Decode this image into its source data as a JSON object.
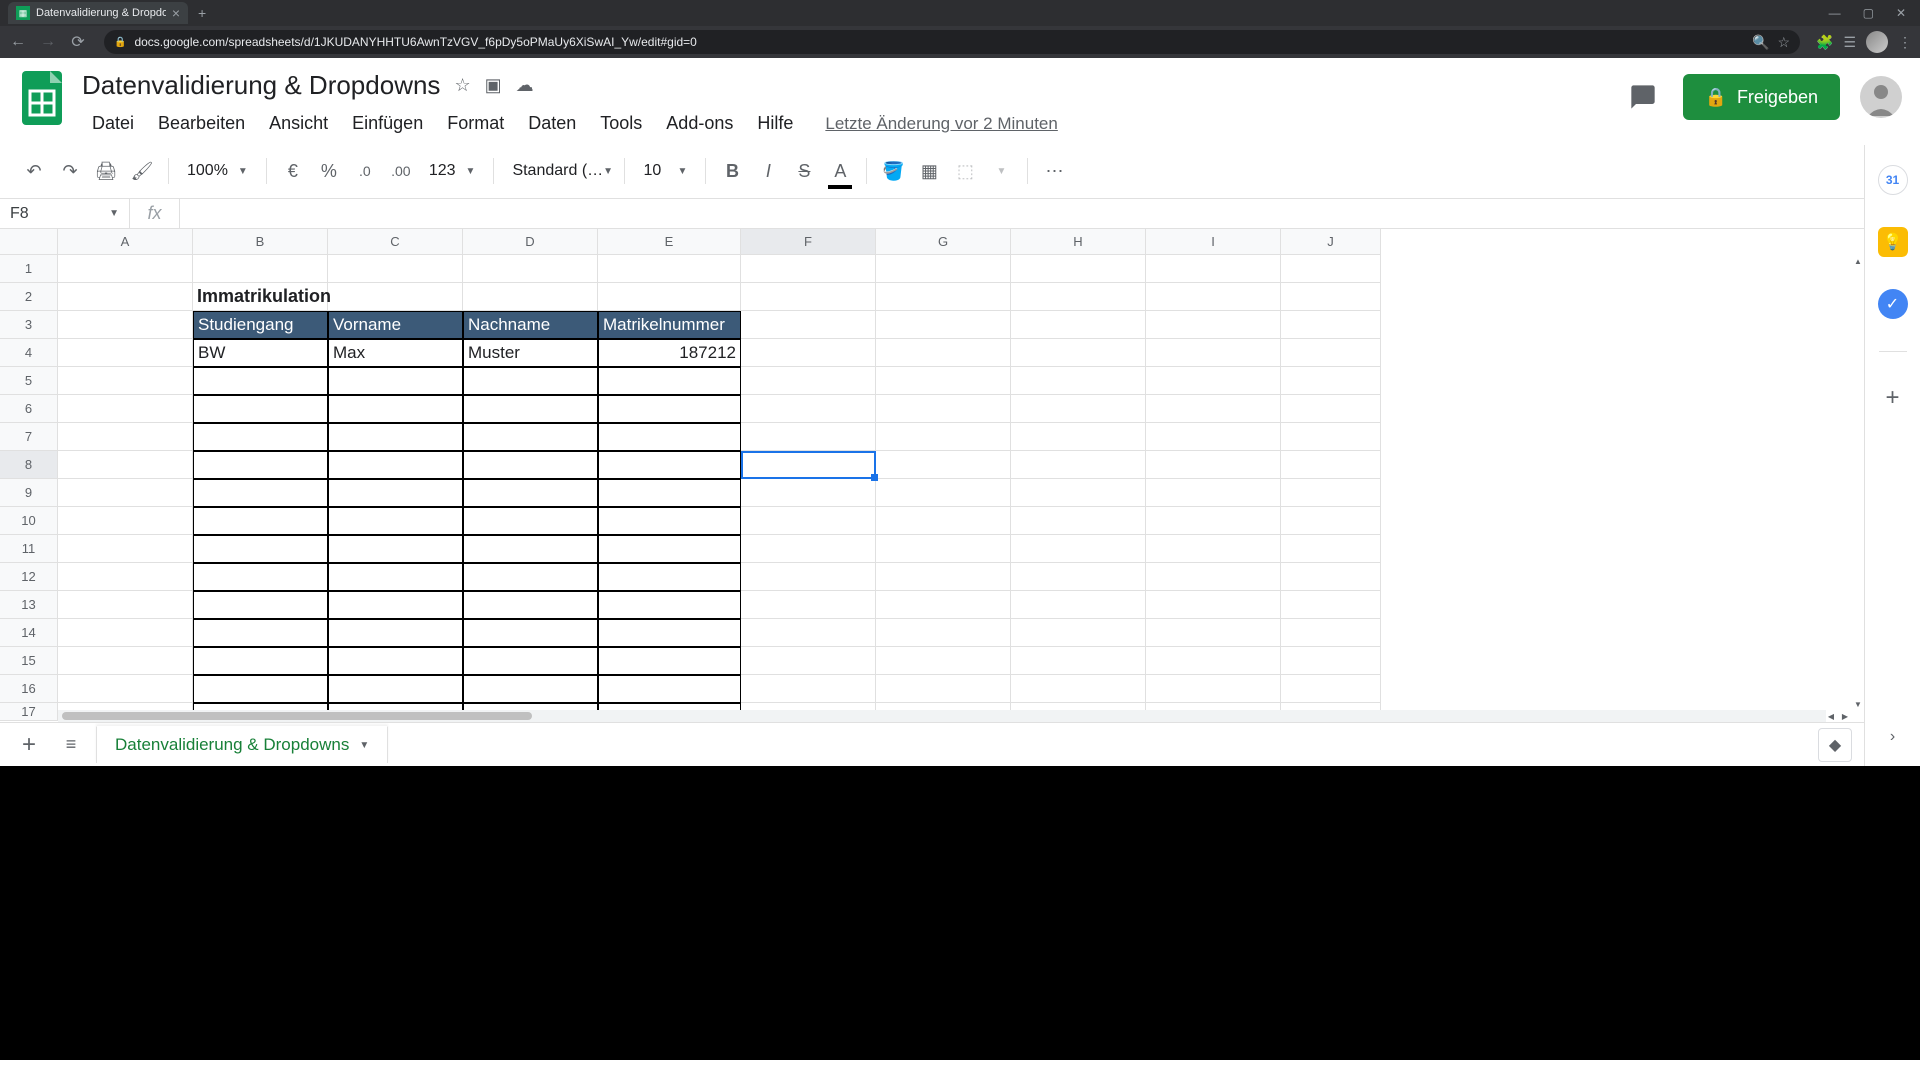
{
  "browser": {
    "tab_title": "Datenvalidierung & Dropdowns",
    "url": "docs.google.com/spreadsheets/d/1JKUDANYHHTU6AwnTzVGV_f6pDy5oPMaUy6XiSwAI_Yw/edit#gid=0"
  },
  "doc": {
    "title": "Datenvalidierung & Dropdowns",
    "last_edit": "Letzte Änderung vor 2 Minuten"
  },
  "menu": {
    "datei": "Datei",
    "bearbeiten": "Bearbeiten",
    "ansicht": "Ansicht",
    "einfuegen": "Einfügen",
    "format": "Format",
    "daten": "Daten",
    "tools": "Tools",
    "addons": "Add-ons",
    "hilfe": "Hilfe"
  },
  "share": {
    "label": "Freigeben"
  },
  "toolbar": {
    "zoom": "100%",
    "currency": "€",
    "percent": "%",
    "dec_less": ".0",
    "dec_more": ".00",
    "numfmt": "123",
    "font": "Standard (…",
    "fontsize": "10"
  },
  "namebox": {
    "ref": "F8"
  },
  "fx": "fx",
  "columns": [
    "A",
    "B",
    "C",
    "D",
    "E",
    "F",
    "G",
    "H",
    "I",
    "J"
  ],
  "rows": [
    "1",
    "2",
    "3",
    "4",
    "5",
    "6",
    "7",
    "8",
    "9",
    "10",
    "11",
    "12",
    "13",
    "14",
    "15",
    "16",
    "17"
  ],
  "table": {
    "title": "Immatrikulation",
    "headers": {
      "studiengang": "Studiengang",
      "vorname": "Vorname",
      "nachname": "Nachname",
      "matrikelnummer": "Matrikelnummer"
    },
    "row1": {
      "studiengang": "BW",
      "vorname": "Max",
      "nachname": "Muster",
      "matrikelnummer": "187212"
    }
  },
  "sheet_tab": {
    "name": "Datenvalidierung & Dropdowns"
  },
  "sidepanel": {
    "cal": "31"
  }
}
